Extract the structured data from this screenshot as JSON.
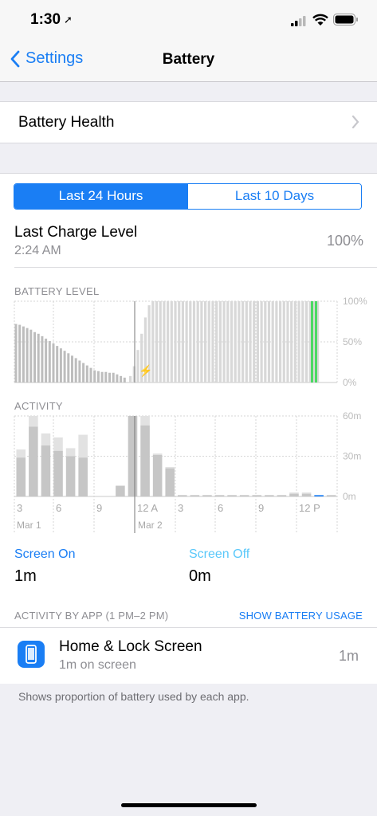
{
  "status_bar": {
    "time": "1:30"
  },
  "nav": {
    "back_label": "Settings",
    "title": "Battery"
  },
  "battery_health": {
    "label": "Battery Health"
  },
  "segments": {
    "active": "Last 24 Hours",
    "inactive": "Last 10 Days"
  },
  "last_charge": {
    "label": "Last Charge Level",
    "time": "2:24 AM",
    "value": "100%"
  },
  "battery_level": {
    "heading": "BATTERY LEVEL",
    "y_ticks": [
      "100%",
      "50%",
      "0%"
    ]
  },
  "activity": {
    "heading": "ACTIVITY",
    "y_ticks": [
      "60m",
      "30m",
      "0m"
    ]
  },
  "chart_data": [
    {
      "type": "bar",
      "title": "BATTERY LEVEL",
      "ylabel": "",
      "ylim": [
        0,
        100
      ],
      "y_ticks": [
        "100%",
        "50%",
        "0%"
      ],
      "x_ticks": [
        "3",
        "6",
        "9",
        "12 A",
        "3",
        "6",
        "9",
        "12 P"
      ],
      "x_dates": [
        "Mar 1",
        "Mar 2"
      ],
      "values": [
        72,
        71,
        69,
        67,
        65,
        62,
        60,
        57,
        54,
        51,
        48,
        45,
        42,
        39,
        36,
        33,
        30,
        27,
        24,
        21,
        18,
        15,
        14,
        13,
        13,
        12,
        12,
        10,
        8,
        6
      ],
      "charging_start_value": 8,
      "charging_segment": "hatched, charged to 100%",
      "last_bars_color": "#4cd964"
    },
    {
      "type": "bar",
      "title": "ACTIVITY",
      "ylim": [
        0,
        60
      ],
      "y_ticks": [
        "60m",
        "30m",
        "0m"
      ],
      "x_ticks": [
        "3",
        "6",
        "9",
        "12 A",
        "3",
        "6",
        "9",
        "12 P"
      ],
      "x_dates": [
        "Mar 1",
        "Mar 2"
      ],
      "series": [
        {
          "name": "Screen On",
          "values": [
            29,
            52,
            38,
            34,
            30,
            29,
            0,
            0,
            8,
            60,
            53,
            31,
            21,
            1,
            1,
            1,
            1,
            1,
            1,
            1,
            1,
            1,
            2,
            2,
            1,
            1
          ]
        },
        {
          "name": "Screen Off",
          "values": [
            6,
            8,
            9,
            10,
            6,
            17,
            0,
            0,
            0,
            0,
            7,
            1,
            1,
            0,
            0,
            0,
            0,
            0,
            0,
            0,
            0,
            0,
            1,
            1,
            0,
            0
          ]
        }
      ]
    }
  ],
  "screen_on": {
    "label": "Screen On",
    "value": "1m"
  },
  "screen_off": {
    "label": "Screen Off",
    "value": "0m"
  },
  "activity_by_app": {
    "heading": "ACTIVITY BY APP (1 PM–2 PM)",
    "action": "SHOW BATTERY USAGE"
  },
  "app_row": {
    "name": "Home & Lock Screen",
    "subtitle": "1m on screen",
    "value": "1m",
    "icon": "phone-screen-icon"
  },
  "footnote": "Shows proportion of battery used by each app.",
  "colors": {
    "accent": "#1a7ef4",
    "screen_off": "#5ac8fa",
    "green": "#4cd964"
  }
}
